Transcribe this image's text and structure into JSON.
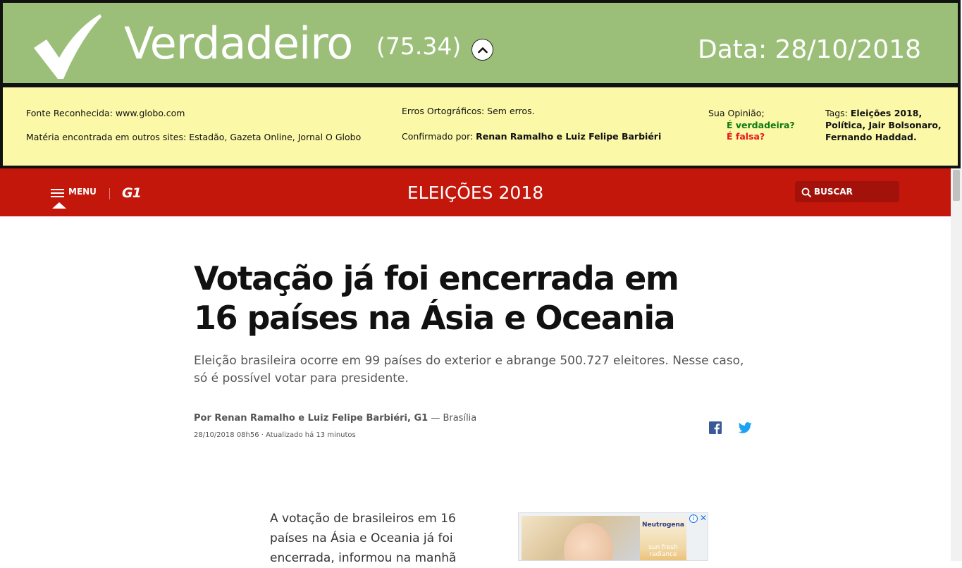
{
  "verdict": {
    "label": "Verdadeiro",
    "score": "(75.34)",
    "date": "Data: 28/10/2018",
    "check_icon": "checkmark-icon",
    "toggle_icon": "chevron-up-icon",
    "background_color": "#9bbf78"
  },
  "info": {
    "fonte": "Fonte Reconhecida: www.globo.com",
    "outros_sites": "Matéria encontrada em outros sites: Estadão, Gazeta Online, Jornal O Globo",
    "erros": "Erros Ortográficos: Sem erros.",
    "confirmado_prefix": "Confirmado por: ",
    "confirmado_names": "Renan Ramalho e Luiz Felipe Barbiéri",
    "opiniao_label": "Sua Opinião;",
    "opiniao_verdadeira": "É verdadeira?",
    "opiniao_falsa": "É falsa?",
    "tags_prefix": "Tags: ",
    "tags": "Eleições 2018, Política, Jair Bolsonaro, Fernando Haddad.",
    "background_color": "#fbf8a7"
  },
  "nav": {
    "menu_label": "MENU",
    "logo": "G1",
    "section": "ELEIÇÕES 2018",
    "search_label": "BUSCAR",
    "brand_color": "#c4170c"
  },
  "article": {
    "headline": "Votação já foi encerrada em 16 países na Ásia e Oceania",
    "subtitle": "Eleição brasileira ocorre em 99 países do exterior e abrange 500.727 eleitores. Nesse caso, só é possível votar para presidente.",
    "byline_author": "Por Renan Ramalho e Luiz Felipe Barbiéri, G1",
    "byline_location": " — Brasília",
    "timestamp": "28/10/2018 08h56 · Atualizado há 13 minutos",
    "body": "A votação de brasileiros em 16 países na Ásia e Oceania já foi encerrada, informou na manhã"
  },
  "ad": {
    "brand": "Neutrogena",
    "product": "sun fresh radiance"
  }
}
